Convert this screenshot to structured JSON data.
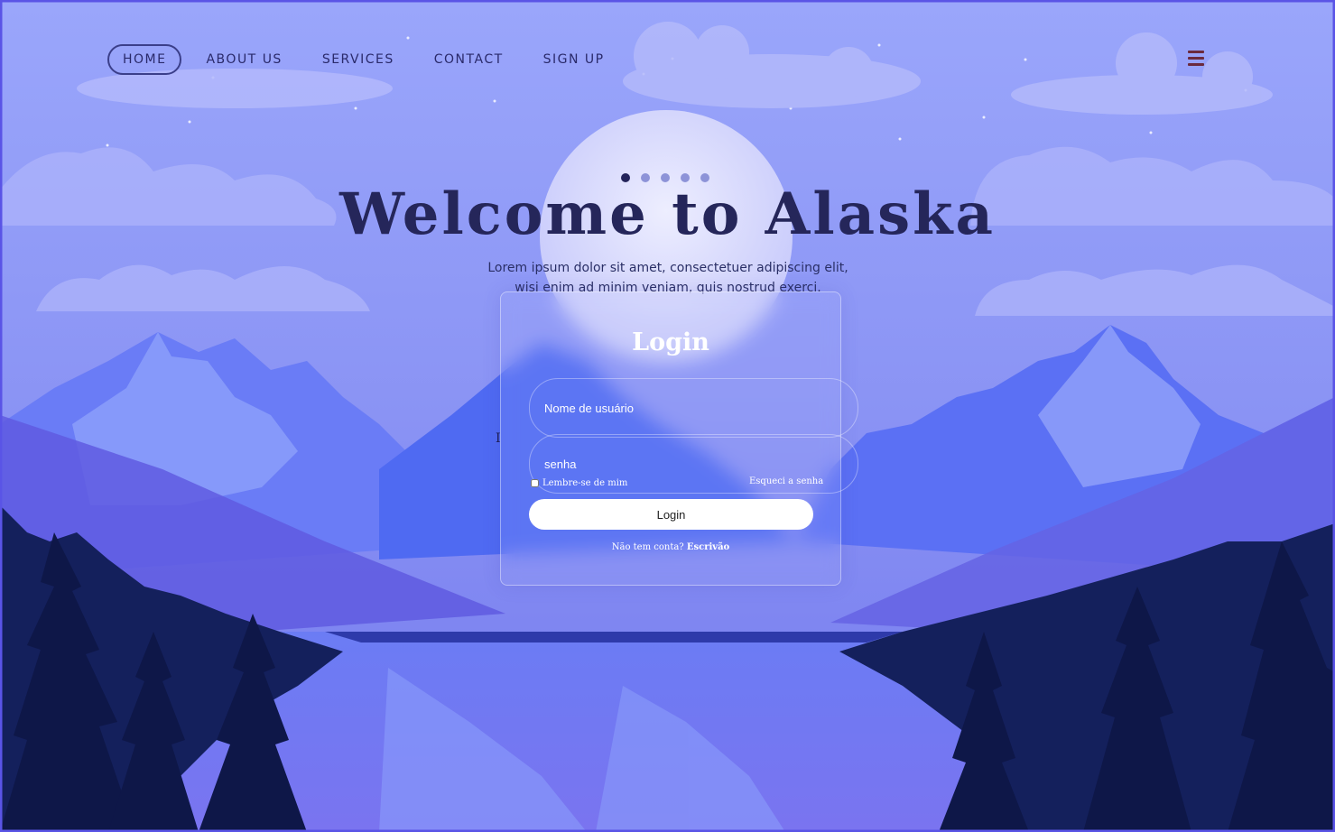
{
  "colors": {
    "sky_top": "#97a4fb",
    "sky_bottom": "#8289f2",
    "mountain": "#4f6cf0",
    "forest": "#13205a",
    "title": "#25265a",
    "nav_text": "#2a2a6a",
    "card_text": "#ffffff"
  },
  "nav": {
    "items": [
      {
        "label": "HOME",
        "active": true
      },
      {
        "label": "ABOUT US",
        "active": false
      },
      {
        "label": "SERVICES",
        "active": false
      },
      {
        "label": "CONTACT",
        "active": false
      },
      {
        "label": "SIGN UP",
        "active": false
      }
    ],
    "menu_icon": "hamburger-icon"
  },
  "carousel": {
    "total": 5,
    "active_index": 0
  },
  "hero": {
    "title": "Welcome to Alaska",
    "text": "Lorem ipsum dolor sit amet, consectetuer adipiscing elit, wisi enim ad minim veniam, quis nostrud exerci.",
    "stray_char": "I"
  },
  "login": {
    "title": "Login",
    "username_placeholder": "Nome de usuário",
    "password_placeholder": "senha",
    "remember_label": "Lembre-se de mim",
    "forgot_label": "Esqueci a senha",
    "button_label": "Login",
    "register_prompt": "Não tem conta?",
    "register_link": "Escrivão"
  }
}
